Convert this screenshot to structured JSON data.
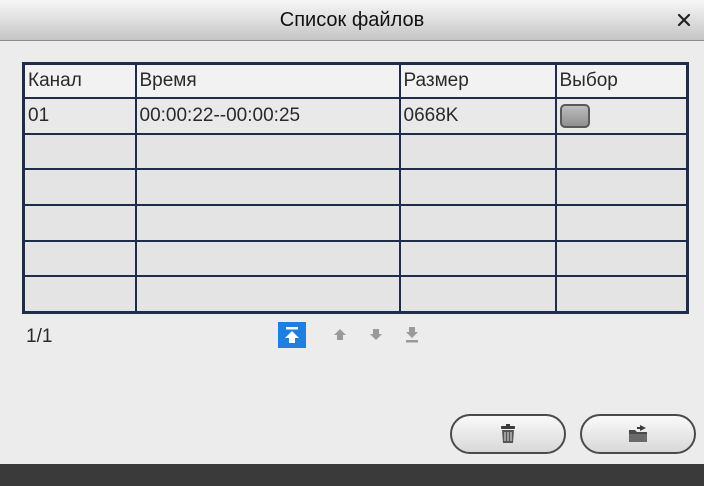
{
  "dialog": {
    "title": "Список файлов"
  },
  "table": {
    "headers": [
      "Канал",
      "Время",
      "Размер",
      "Выбор"
    ],
    "rows": [
      {
        "channel": "01",
        "time": "00:00:22--00:00:25",
        "size": "0668K",
        "selected": false
      }
    ],
    "empty_rows": 5
  },
  "pagination": {
    "page_info": "1/1"
  },
  "icons": {
    "close": "close-icon",
    "nav_first": "arrow-to-top-icon",
    "nav_prev": "arrow-up-icon",
    "nav_next": "arrow-down-icon",
    "nav_last": "arrow-to-bottom-icon",
    "delete": "trash-icon",
    "export": "folder-export-icon"
  },
  "colors": {
    "table_border": "#1f2d4d",
    "active_nav": "#1f7fe0"
  }
}
